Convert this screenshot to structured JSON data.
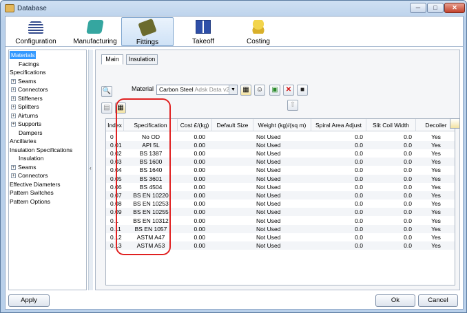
{
  "window": {
    "title": "Database",
    "minimize": "─",
    "maximize": "□",
    "close": "✕"
  },
  "ribbon": {
    "tabs": [
      {
        "label": "Configuration",
        "icon": "configuration-icon"
      },
      {
        "label": "Manufacturing",
        "icon": "manufacturing-icon"
      },
      {
        "label": "Fittings",
        "icon": "fittings-icon",
        "active": true
      },
      {
        "label": "Takeoff",
        "icon": "takeoff-icon"
      },
      {
        "label": "Costing",
        "icon": "costing-icon"
      }
    ]
  },
  "sidebar": {
    "items": [
      {
        "label": "Materials",
        "selected": true
      },
      {
        "label": "Facings"
      },
      {
        "label": "Specifications"
      },
      {
        "label": "Seams",
        "expand": "+"
      },
      {
        "label": "Connectors",
        "expand": "+"
      },
      {
        "label": "Stiffeners",
        "expand": "+"
      },
      {
        "label": "Splitters",
        "expand": "+"
      },
      {
        "label": "Airturns",
        "expand": "+"
      },
      {
        "label": "Supports",
        "expand": "+"
      },
      {
        "label": "Dampers"
      },
      {
        "label": "Ancillaries"
      },
      {
        "label": "Insulation Specifications"
      },
      {
        "label": "Insulation"
      },
      {
        "label": "Seams",
        "expand": "+"
      },
      {
        "label": "Connectors",
        "expand": "+"
      },
      {
        "label": "Effective Diameters"
      },
      {
        "label": "Pattern Switches"
      },
      {
        "label": "Pattern Options"
      }
    ]
  },
  "main": {
    "subtabs": [
      {
        "label": "Main"
      },
      {
        "label": "Insulation"
      }
    ],
    "material_label": "Material",
    "material_value": "Carbon Steel",
    "material_ghost": "Adsk Data v2"
  },
  "table": {
    "columns": [
      "Index",
      "Specification",
      "Cost £/(kg)",
      "Default Size",
      "Weight (kg)/(sq m)",
      "Spiral Area Adjust",
      "Slit Coil Width",
      "Decoiler"
    ],
    "rows": [
      [
        "0",
        "No OD",
        "0.00",
        "",
        "Not Used",
        "0.0",
        "0.0",
        "Yes"
      ],
      [
        "0.01",
        "API 5L",
        "0.00",
        "",
        "Not Used",
        "0.0",
        "0.0",
        "Yes"
      ],
      [
        "0.02",
        "BS 1387",
        "0.00",
        "",
        "Not Used",
        "0.0",
        "0.0",
        "Yes"
      ],
      [
        "0.03",
        "BS 1600",
        "0.00",
        "",
        "Not Used",
        "0.0",
        "0.0",
        "Yes"
      ],
      [
        "0.04",
        "BS 1640",
        "0.00",
        "",
        "Not Used",
        "0.0",
        "0.0",
        "Yes"
      ],
      [
        "0.05",
        "BS 3601",
        "0.00",
        "",
        "Not Used",
        "0.0",
        "0.0",
        "Yes"
      ],
      [
        "0.06",
        "BS 4504",
        "0.00",
        "",
        "Not Used",
        "0.0",
        "0.0",
        "Yes"
      ],
      [
        "0.07",
        "BS EN 10220",
        "0.00",
        "",
        "Not Used",
        "0.0",
        "0.0",
        "Yes"
      ],
      [
        "0.08",
        "BS EN 10253",
        "0.00",
        "",
        "Not Used",
        "0.0",
        "0.0",
        "Yes"
      ],
      [
        "0.09",
        "BS EN 10255",
        "0.00",
        "",
        "Not Used",
        "0.0",
        "0.0",
        "Yes"
      ],
      [
        "0.1",
        "BS EN 10312",
        "0.00",
        "",
        "Not Used",
        "0.0",
        "0.0",
        "Yes"
      ],
      [
        "0.11",
        "BS EN 1057",
        "0.00",
        "",
        "Not Used",
        "0.0",
        "0.0",
        "Yes"
      ],
      [
        "0.12",
        "ASTM A47",
        "0.00",
        "",
        "Not Used",
        "0.0",
        "0.0",
        "Yes"
      ],
      [
        "0.13",
        "ASTM A53",
        "0.00",
        "",
        "Not Used",
        "0.0",
        "0.0",
        "Yes"
      ]
    ]
  },
  "footer": {
    "apply": "Apply",
    "ok": "Ok",
    "cancel": "Cancel"
  },
  "colors": {
    "highlight": "#e02020",
    "selection": "#3399ff"
  }
}
